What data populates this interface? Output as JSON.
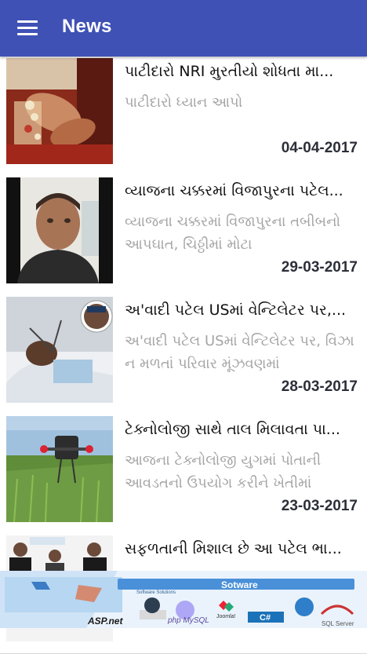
{
  "appbar": {
    "title": "News",
    "menu_icon": "hamburger-menu-icon",
    "color": "#3f51b5"
  },
  "news": [
    {
      "title": "પાટીદારો NRI મુરતીયો શોધતા મા...",
      "description": "પાટીદારો ધ્યાન આપો",
      "date": "04-04-2017",
      "image": "wedding-hands-photo"
    },
    {
      "title": "વ્યાજના ચક્કરમાં વિજાપુરના પટેલ...",
      "description": "વ્યાજના ચક્કરમાં વિજાપુરના તબીબનો આપઘાત, ચિઠ્ઠીમાં મોટા",
      "date": "29-03-2017",
      "image": "man-portrait-photo"
    },
    {
      "title": "અ'વાદી પટેલ USમાં વેન્ટિલેટર પર,...",
      "description": "અ'વાદી પટેલ USમાં વેન્ટિલેટર પર, વિઝા ન મળતાં પરિવાર મૂંઝવણમાં",
      "date": "28-03-2017",
      "image": "hospital-patient-photo"
    },
    {
      "title": "ટેક્નોલોજી સાથે તાલ મિલાવતા પા...",
      "description": "આજના ટેક્નોલોજી યુગમાં પોતાની આવડતનો ઉપયોગ કરીને ખેતીમાં",
      "date": "23-03-2017",
      "image": "farm-drone-photo"
    },
    {
      "title": "સફળતાની મિશાલ છે આ પટેલ ભા...",
      "description": "",
      "date": "",
      "image": "students-group-photo"
    }
  ],
  "ad_banner": {
    "heading": "Sotware",
    "tagline": "Software Solutions",
    "tech_labels": [
      "ASP.net",
      "php MySQL",
      "Joomla!",
      "C#",
      "SQL Server"
    ]
  }
}
